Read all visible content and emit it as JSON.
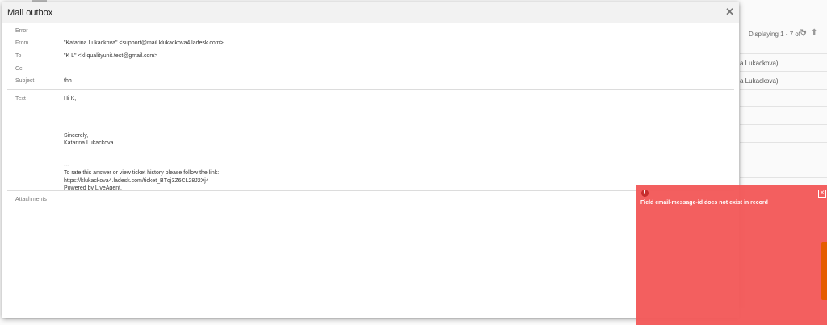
{
  "background": {
    "displaying": "Displaying 1 - 7 of 7",
    "rows": [
      "a Lukackova)",
      "a Lukackova)",
      "",
      "",
      "",
      "",
      ""
    ]
  },
  "modal": {
    "title": "Mail outbox",
    "fields": {
      "error_label": "Error",
      "from_label": "From",
      "from_value": "\"Katarina Lukackova\" <support@mail.klukackova4.ladesk.com>",
      "to_label": "To",
      "to_value": "\"K L\" <kl.qualityunit.test@gmail.com>",
      "cc_label": "Cc",
      "subject_label": "Subject",
      "subject_value": "thh",
      "text_label": "Text",
      "attachments_label": "Attachments"
    },
    "text": {
      "greeting": "Hi K,",
      "closing": "Sincerely,",
      "signature": "Katarina Lukackova",
      "separator": "---",
      "rate_line": "To rate this answer or view ticket history please follow the link:",
      "link": "https://klukackova4.ladesk.com/ticket_BTqj3Z6CL28J2Xj4",
      "powered": "Powered by LiveAgent."
    }
  },
  "notification": {
    "message": "Field email-message-id does not exist in record",
    "color": "#f35a5a"
  }
}
